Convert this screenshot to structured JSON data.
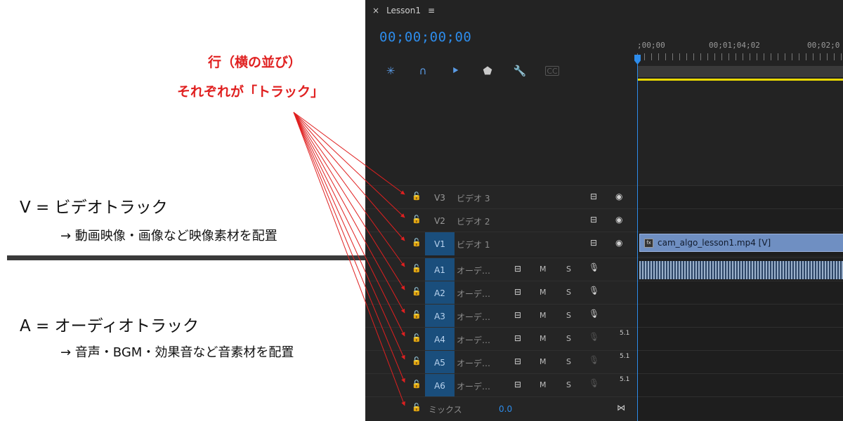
{
  "annotations": {
    "title_line1": "行（横の並び）",
    "title_line2": "それぞれが「トラック」",
    "video_heading": "V = ビデオトラック",
    "video_desc": "→ 動画映像・画像など映像素材を配置",
    "audio_heading": "A = オーディオトラック",
    "audio_desc": "→ 音声・BGM・効果音など音素材を配置",
    "arrow_color": "#e02020"
  },
  "sequence": {
    "tab_title": "Lesson1",
    "close_glyph": "×",
    "menu_glyph": "≡",
    "timecode": "00;00;00;00",
    "ruler_labels": [
      ";00;00",
      "00;01;04;02",
      "00;02;0"
    ]
  },
  "toolbar": {
    "icons": [
      "snap-icon",
      "linked-selection-icon",
      "add-marker-icon",
      "marker-icon",
      "wrench-icon",
      "captions-icon"
    ],
    "captions_label": "CC"
  },
  "video_tracks": [
    {
      "id": "V3",
      "label": "ビデオ 3",
      "selected": false,
      "clip": ""
    },
    {
      "id": "V2",
      "label": "ビデオ 2",
      "selected": false,
      "clip": ""
    },
    {
      "id": "V1",
      "label": "ビデオ 1",
      "selected": true,
      "clip": "cam_algo_lesson1.mp4 [V]"
    }
  ],
  "audio_tracks": [
    {
      "id": "A1",
      "label": "オーデ…",
      "m": "M",
      "s": "S",
      "channels": "",
      "has_clip": true
    },
    {
      "id": "A2",
      "label": "オーデ…",
      "m": "M",
      "s": "S",
      "channels": "",
      "has_clip": false
    },
    {
      "id": "A3",
      "label": "オーデ…",
      "m": "M",
      "s": "S",
      "channels": "",
      "has_clip": false
    },
    {
      "id": "A4",
      "label": "オーデ…",
      "m": "M",
      "s": "S",
      "channels": "5.1",
      "has_clip": false
    },
    {
      "id": "A5",
      "label": "オーデ…",
      "m": "M",
      "s": "S",
      "channels": "5.1",
      "has_clip": false
    },
    {
      "id": "A6",
      "label": "オーデ…",
      "m": "M",
      "s": "S",
      "channels": "5.1",
      "has_clip": false
    }
  ],
  "mix": {
    "label": "ミックス",
    "value": "0.0"
  },
  "colors": {
    "panel_bg": "#232323",
    "accent_blue": "#2d8ceb",
    "selected_track": "#1a4e7c",
    "clip_video": "#6f8fc2",
    "in_out_bar": "#e8d800"
  }
}
